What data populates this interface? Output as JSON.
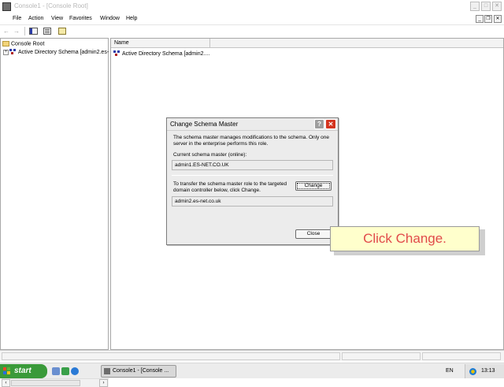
{
  "window": {
    "title": "Console1 - [Console Root]",
    "controls": {
      "minimize": "_",
      "maximize": "□",
      "close": "✕"
    }
  },
  "menu": {
    "items": [
      "File",
      "Action",
      "View",
      "Favorites",
      "Window",
      "Help"
    ],
    "mdi_controls": {
      "minimize": "_",
      "restore": "❐",
      "close": "✕"
    }
  },
  "toolbar": {
    "back": "←",
    "forward": "→"
  },
  "tree": {
    "root_label": "Console Root",
    "child_label": "Active Directory Schema [admin2.es-"
  },
  "list": {
    "columns": [
      "Name"
    ],
    "items": [
      "Active Directory Schema [admin2...."
    ]
  },
  "scrollbar": {
    "left_arrow": "‹",
    "right_arrow": "›"
  },
  "dialog": {
    "title": "Change Schema Master",
    "help_label": "?",
    "close_label": "✕",
    "intro_line1": "The schema master manages modifications to the schema. Only one",
    "intro_line2": "server in the enterprise performs this role.",
    "current_label": "Current schema master (online):",
    "current_value": "admin1.ES-NET.CO.UK",
    "transfer_line1": "To transfer the schema master role to the targeted",
    "transfer_line2": "domain controller below, click Change.",
    "target_value": "admin2.es-net.co.uk",
    "change_button": "Change",
    "close_button": "Close"
  },
  "callout": {
    "text": "Click Change."
  },
  "taskbar": {
    "start_label": "start",
    "task_label": "Console1 - [Console ...",
    "language": "EN",
    "clock": "13:13"
  },
  "colors": {
    "start_green": "#3a9a3a",
    "close_red": "#d4341f",
    "callout_bg": "#ffffcc",
    "callout_text": "#e14a4a"
  }
}
